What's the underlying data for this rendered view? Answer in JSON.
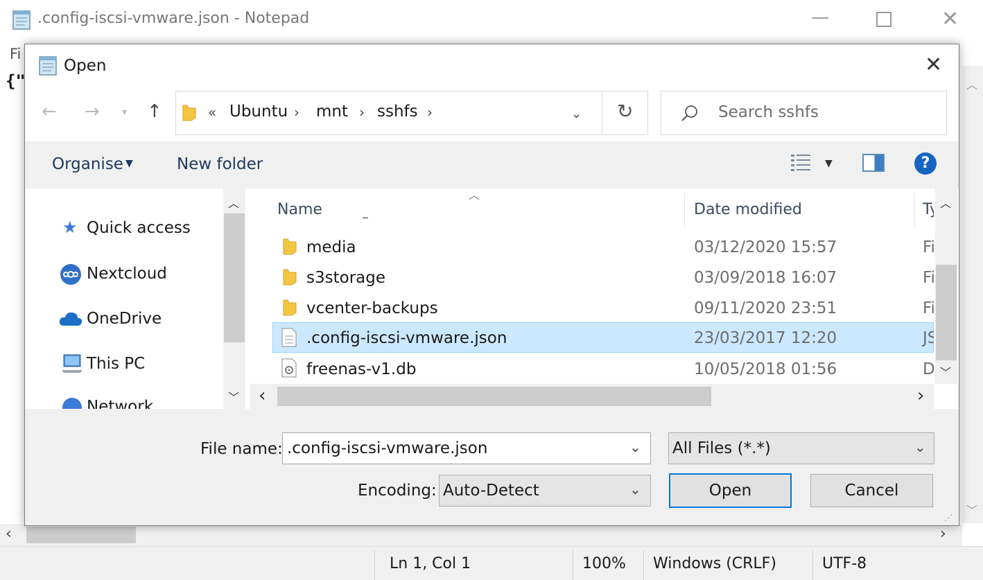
{
  "notepad": {
    "title": ".config-iscsi-vmware.json - Notepad",
    "menu_partial": "Fi",
    "content_partial": "{\"",
    "status": {
      "position": "Ln 1, Col 1",
      "zoom": "100%",
      "line_ending": "Windows (CRLF)",
      "encoding": "UTF-8"
    }
  },
  "dialog": {
    "title": "Open",
    "breadcrumb": {
      "overflow": "«",
      "items": [
        "Ubuntu",
        "mnt",
        "sshfs"
      ]
    },
    "search": {
      "placeholder": "Search sshfs"
    },
    "toolbar": {
      "organise": "Organise",
      "new_folder": "New folder"
    },
    "nav": {
      "items": [
        {
          "label": "Quick access",
          "icon": "star-icon"
        },
        {
          "label": "Nextcloud",
          "icon": "nextcloud-icon"
        },
        {
          "label": "OneDrive",
          "icon": "cloud-icon"
        },
        {
          "label": "This PC",
          "icon": "computer-icon"
        },
        {
          "label": "Network",
          "icon": "network-icon"
        }
      ]
    },
    "columns": {
      "name": "Name",
      "date": "Date modified",
      "type": "Ty"
    },
    "files": [
      {
        "name": "media",
        "date": "03/12/2020 15:57",
        "type": "Fi",
        "kind": "folder"
      },
      {
        "name": "s3storage",
        "date": "03/09/2018 16:07",
        "type": "Fi",
        "kind": "folder"
      },
      {
        "name": "vcenter-backups",
        "date": "09/11/2020 23:51",
        "type": "Fi",
        "kind": "folder"
      },
      {
        "name": ".config-iscsi-vmware.json",
        "date": "23/03/2017 12:20",
        "type": "JS",
        "kind": "file",
        "selected": true
      },
      {
        "name": "freenas-v1.db",
        "date": "10/05/2018 01:56",
        "type": "D",
        "kind": "db"
      }
    ],
    "footer": {
      "file_name_label": "File name:",
      "file_name_value": ".config-iscsi-vmware.json",
      "filter_value": "All Files  (*.*)",
      "encoding_label": "Encoding:",
      "encoding_value": "Auto-Detect",
      "open_button": "Open",
      "cancel_button": "Cancel"
    }
  },
  "colors": {
    "selection": "#cce8ff",
    "selection_border": "#99d1ff",
    "folder": "#f4c443",
    "help": "#1565c0",
    "accent_border": "#0078d7"
  }
}
